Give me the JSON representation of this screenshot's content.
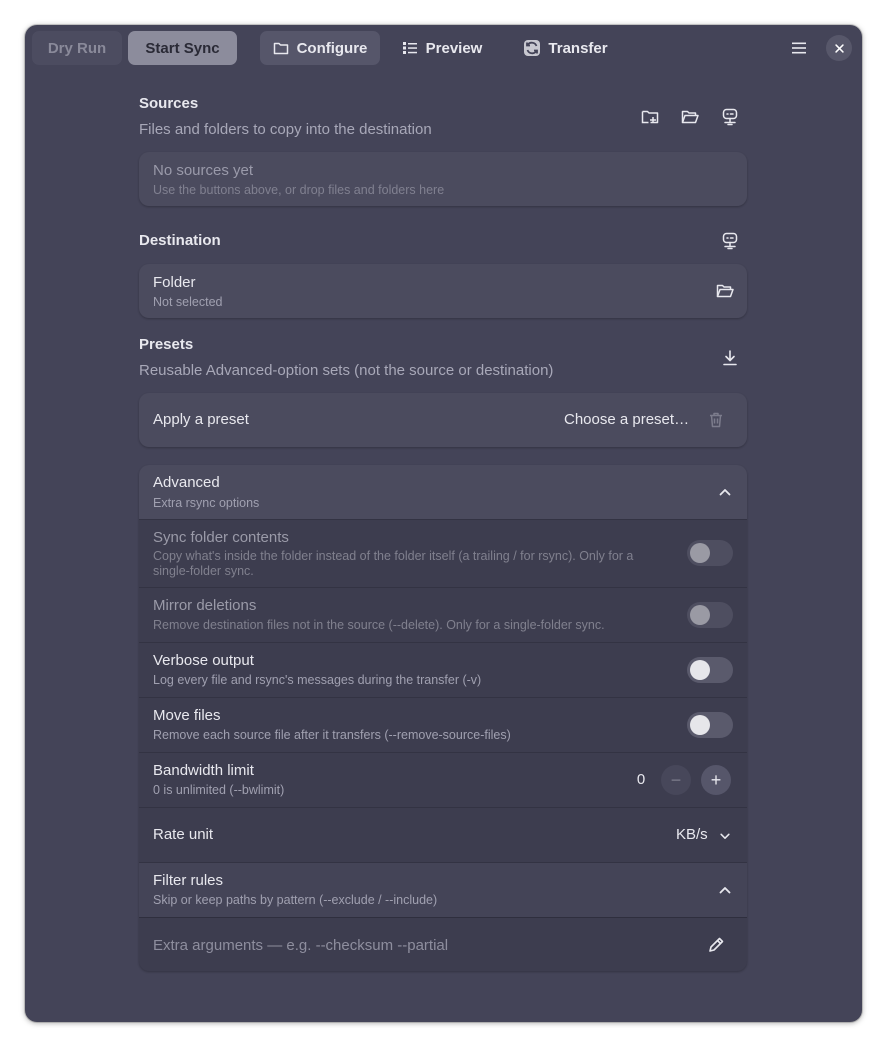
{
  "header": {
    "dry_run_label": "Dry Run",
    "start_sync_label": "Start Sync",
    "tabs": [
      {
        "label": "Configure",
        "icon": "folder-icon",
        "active": true
      },
      {
        "label": "Preview",
        "icon": "list-icon",
        "active": false
      },
      {
        "label": "Transfer",
        "icon": "sync-icon",
        "active": false
      }
    ]
  },
  "sources": {
    "title": "Sources",
    "subtitle": "Files and folders to copy into the destination",
    "empty_title": "No sources yet",
    "empty_hint": "Use the buttons above, or drop files and folders here"
  },
  "destination": {
    "title": "Destination",
    "folder_label": "Folder",
    "folder_value": "Not selected"
  },
  "presets": {
    "title": "Presets",
    "subtitle": "Reusable Advanced-option sets (not the source or destination)",
    "apply_label": "Apply a preset",
    "choose_label": "Choose a preset…"
  },
  "advanced": {
    "title": "Advanced",
    "subtitle": "Extra rsync options",
    "options": [
      {
        "title": "Sync folder contents",
        "sub_line1": "Copy what's inside the folder instead of the folder itself (a trailing / for rsync). Only for a",
        "sub_line2": "single-folder sync.",
        "enabled": false,
        "on": false
      },
      {
        "title": "Mirror deletions",
        "sub": "Remove destination files not in the source (--delete). Only for a single-folder sync.",
        "enabled": false,
        "on": false
      },
      {
        "title": "Verbose output",
        "sub": "Log every file and rsync's messages during the transfer (-v)",
        "enabled": true,
        "on": false
      },
      {
        "title": "Move files",
        "sub": "Remove each source file after it transfers (--remove-source-files)",
        "enabled": true,
        "on": false
      }
    ],
    "bandwidth": {
      "title": "Bandwidth limit",
      "sub": "0 is unlimited (--bwlimit)",
      "value": "0",
      "minus": "−",
      "plus": "+"
    },
    "rate_unit": {
      "title": "Rate unit",
      "value": "KB/s"
    },
    "filter": {
      "title": "Filter rules",
      "sub": "Skip or keep paths by pattern (--exclude / --include)"
    },
    "extra_args_placeholder": "Extra arguments — e.g. --checksum --partial"
  },
  "colors": {
    "window_bg": "#444458",
    "card_bg": "#4b4b5e",
    "advanced_bg": "#3d3d4f",
    "accent_button": "#8c8c9c"
  }
}
